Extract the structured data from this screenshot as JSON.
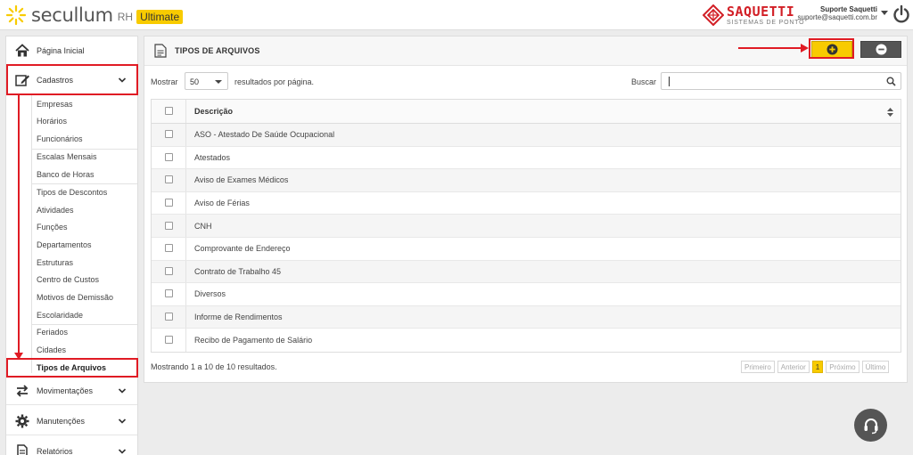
{
  "header": {
    "logo_text": "secullum",
    "logo_rh": "RH",
    "logo_badge": "Ultimate",
    "brand_name": "SAQUETTI",
    "brand_sub": "SISTEMAS DE PONTO",
    "user_name": "Suporte Saquetti",
    "user_email": "suporte@saquetti.com.br"
  },
  "sidebar": {
    "home": "Página Inicial",
    "cadastros": "Cadastros",
    "submenu": [
      "Empresas",
      "Horários",
      "Funcionários",
      "Escalas Mensais",
      "Banco de Horas",
      "Tipos de Descontos",
      "Atividades",
      "Funções",
      "Departamentos",
      "Estruturas",
      "Centro de Custos",
      "Motivos de Demissão",
      "Escolaridade",
      "Feriados",
      "Cidades",
      "Tipos de Arquivos"
    ],
    "movimentacoes": "Movimentações",
    "manutencoes": "Manutenções",
    "relatorios": "Relatórios"
  },
  "panel": {
    "title": "TIPOS DE ARQUIVOS",
    "show_label": "Mostrar",
    "per_page_value": "50",
    "per_page_suffix": "resultados por página.",
    "search_label": "Buscar",
    "column_header": "Descrição",
    "rows": [
      "ASO - Atestado De Saúde Ocupacional",
      "Atestados",
      "Aviso de Exames Médicos",
      "Aviso de Férias",
      "CNH",
      "Comprovante de Endereço",
      "Contrato de Trabalho 45",
      "Diversos",
      "Informe de Rendimentos",
      "Recibo de Pagamento de Salário"
    ],
    "results_text": "Mostrando 1 a 10 de 10 resultados.",
    "pager": {
      "first": "Primeiro",
      "prev": "Anterior",
      "current": "1",
      "next": "Próximo",
      "last": "Último"
    }
  },
  "colors": {
    "accent": "#f8cb00",
    "highlight": "#e01b24",
    "brand_red": "#d21f26",
    "dark_button": "#555555"
  }
}
